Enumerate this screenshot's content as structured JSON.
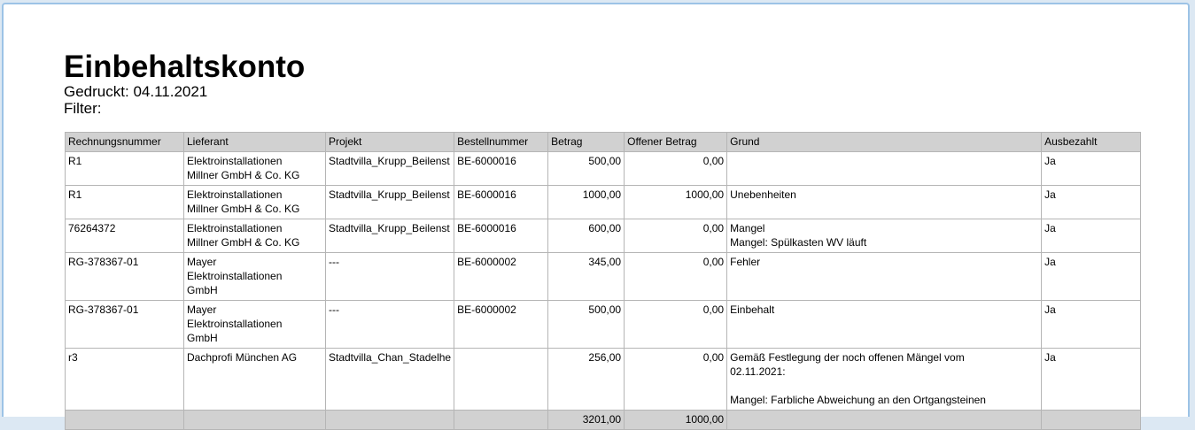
{
  "report": {
    "title": "Einbehaltskonto",
    "printed_label": "Gedruckt:",
    "printed_date": "04.11.2021",
    "filter_label": "Filter:",
    "filter_value": ""
  },
  "table": {
    "columns": [
      "Rechnungsnummer",
      "Lieferant",
      "Projekt",
      "Bestellnummer",
      "Betrag",
      "Offener Betrag",
      "Grund",
      "Ausbezahlt"
    ],
    "rows": [
      {
        "rechnungsnummer": "R1",
        "lieferant": [
          "Elektroinstallationen",
          "Millner GmbH & Co. KG"
        ],
        "projekt": "Stadtvilla_Krupp_Beilenst",
        "bestellnummer": "BE-6000016",
        "betrag": "500,00",
        "offener_betrag": "0,00",
        "grund": [],
        "ausbezahlt": "Ja"
      },
      {
        "rechnungsnummer": "R1",
        "lieferant": [
          "Elektroinstallationen",
          "Millner GmbH & Co. KG"
        ],
        "projekt": "Stadtvilla_Krupp_Beilenst",
        "bestellnummer": "BE-6000016",
        "betrag": "1000,00",
        "offener_betrag": "1000,00",
        "grund": [
          "Unebenheiten"
        ],
        "ausbezahlt": "Ja"
      },
      {
        "rechnungsnummer": "76264372",
        "lieferant": [
          "Elektroinstallationen",
          "Millner GmbH & Co. KG"
        ],
        "projekt": "Stadtvilla_Krupp_Beilenst",
        "bestellnummer": "BE-6000016",
        "betrag": "600,00",
        "offener_betrag": "0,00",
        "grund": [
          "Mangel",
          "Mangel: Spülkasten WV läuft"
        ],
        "ausbezahlt": "Ja"
      },
      {
        "rechnungsnummer": "RG-378367-01",
        "lieferant": [
          "Mayer",
          "Elektroinstallationen",
          "GmbH"
        ],
        "projekt": "---",
        "bestellnummer": "BE-6000002",
        "betrag": "345,00",
        "offener_betrag": "0,00",
        "grund": [
          "Fehler"
        ],
        "ausbezahlt": "Ja"
      },
      {
        "rechnungsnummer": "RG-378367-01",
        "lieferant": [
          "Mayer",
          "Elektroinstallationen",
          "GmbH"
        ],
        "projekt": "---",
        "bestellnummer": "BE-6000002",
        "betrag": "500,00",
        "offener_betrag": "0,00",
        "grund": [
          "Einbehalt"
        ],
        "ausbezahlt": "Ja"
      },
      {
        "rechnungsnummer": "r3",
        "lieferant": [
          "Dachprofi München AG"
        ],
        "projekt": "Stadtvilla_Chan_Stadelhe",
        "bestellnummer": "",
        "betrag": "256,00",
        "offener_betrag": "0,00",
        "grund": [
          "Gemäß Festlegung der noch offenen Mängel vom",
          "02.11.2021:",
          "",
          "Mangel: Farbliche Abweichung an den Ortgangsteinen"
        ],
        "ausbezahlt": "Ja"
      }
    ],
    "totals": {
      "betrag": "3201,00",
      "offener_betrag": "1000,00"
    }
  }
}
